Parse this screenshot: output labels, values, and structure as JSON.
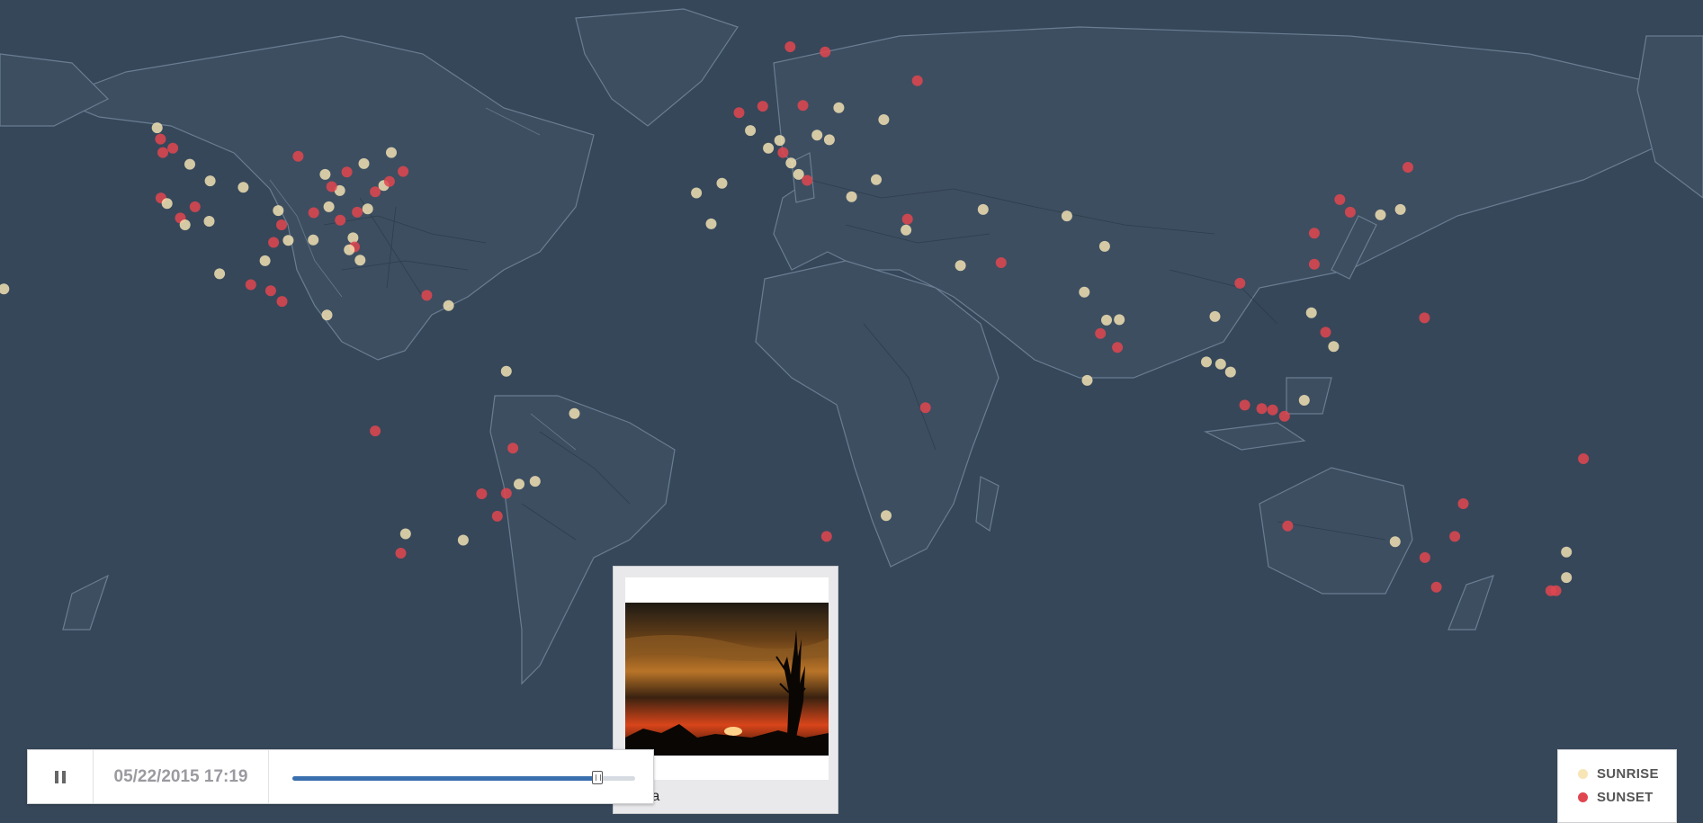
{
  "map": {
    "background": "#36475a",
    "land": "#3d4e61",
    "roads": "#2a3846"
  },
  "colors": {
    "sunrise": "#f7e5b5",
    "sunset": "#e0464f"
  },
  "points": [
    {
      "lon": -122.4,
      "lat": 47.6,
      "type": "sunset"
    },
    {
      "lon": -123.1,
      "lat": 49.3,
      "type": "sunrise"
    },
    {
      "lon": -121.9,
      "lat": 45.5,
      "type": "sunset"
    },
    {
      "lon": -119.8,
      "lat": 46.2,
      "type": "sunset"
    },
    {
      "lon": -116.2,
      "lat": 43.6,
      "type": "sunrise"
    },
    {
      "lon": -122.3,
      "lat": 37.8,
      "type": "sunset"
    },
    {
      "lon": -121.0,
      "lat": 36.8,
      "type": "sunrise"
    },
    {
      "lon": -118.2,
      "lat": 34.1,
      "type": "sunset"
    },
    {
      "lon": -117.2,
      "lat": 32.8,
      "type": "sunrise"
    },
    {
      "lon": -115.1,
      "lat": 36.2,
      "type": "sunset"
    },
    {
      "lon": -112.1,
      "lat": 33.5,
      "type": "sunrise"
    },
    {
      "lon": -111.9,
      "lat": 40.8,
      "type": "sunrise"
    },
    {
      "lon": -104.9,
      "lat": 39.7,
      "type": "sunrise"
    },
    {
      "lon": -97.5,
      "lat": 35.5,
      "type": "sunrise"
    },
    {
      "lon": -96.8,
      "lat": 32.8,
      "type": "sunset"
    },
    {
      "lon": -95.4,
      "lat": 29.8,
      "type": "sunrise"
    },
    {
      "lon": -98.5,
      "lat": 29.4,
      "type": "sunset"
    },
    {
      "lon": -90.1,
      "lat": 29.9,
      "type": "sunrise"
    },
    {
      "lon": -90.0,
      "lat": 35.1,
      "type": "sunset"
    },
    {
      "lon": -86.8,
      "lat": 36.2,
      "type": "sunrise"
    },
    {
      "lon": -84.4,
      "lat": 33.7,
      "type": "sunset"
    },
    {
      "lon": -81.7,
      "lat": 30.3,
      "type": "sunrise"
    },
    {
      "lon": -80.2,
      "lat": 25.8,
      "type": "sunrise"
    },
    {
      "lon": -81.4,
      "lat": 28.5,
      "type": "sunset"
    },
    {
      "lon": -82.5,
      "lat": 27.9,
      "type": "sunrise"
    },
    {
      "lon": -80.8,
      "lat": 35.2,
      "type": "sunset"
    },
    {
      "lon": -78.6,
      "lat": 35.8,
      "type": "sunrise"
    },
    {
      "lon": -77.0,
      "lat": 38.9,
      "type": "sunset"
    },
    {
      "lon": -75.2,
      "lat": 40.0,
      "type": "sunrise"
    },
    {
      "lon": -74.0,
      "lat": 40.7,
      "type": "sunset"
    },
    {
      "lon": -71.1,
      "lat": 42.4,
      "type": "sunset"
    },
    {
      "lon": -79.4,
      "lat": 43.7,
      "type": "sunrise"
    },
    {
      "lon": -83.0,
      "lat": 42.3,
      "type": "sunset"
    },
    {
      "lon": -87.6,
      "lat": 41.9,
      "type": "sunrise"
    },
    {
      "lon": -93.3,
      "lat": 44.9,
      "type": "sunset"
    },
    {
      "lon": -84.5,
      "lat": 39.1,
      "type": "sunrise"
    },
    {
      "lon": -86.2,
      "lat": 39.8,
      "type": "sunset"
    },
    {
      "lon": -73.6,
      "lat": 45.5,
      "type": "sunrise"
    },
    {
      "lon": -99.1,
      "lat": 19.4,
      "type": "sunset"
    },
    {
      "lon": -103.3,
      "lat": 20.7,
      "type": "sunset"
    },
    {
      "lon": -100.3,
      "lat": 25.7,
      "type": "sunrise"
    },
    {
      "lon": -109.9,
      "lat": 23.0,
      "type": "sunrise"
    },
    {
      "lon": -96.7,
      "lat": 17.1,
      "type": "sunset"
    },
    {
      "lon": -87.2,
      "lat": 14.1,
      "type": "sunrise"
    },
    {
      "lon": -66.1,
      "lat": 18.4,
      "type": "sunset"
    },
    {
      "lon": -61.5,
      "lat": 16.2,
      "type": "sunrise"
    },
    {
      "lon": -49.3,
      "lat": 1.5,
      "type": "sunrise"
    },
    {
      "lon": -34.9,
      "lat": -8.1,
      "type": "sunrise"
    },
    {
      "lon": -77.0,
      "lat": -12.0,
      "type": "sunset"
    },
    {
      "lon": -46.6,
      "lat": -23.5,
      "type": "sunrise"
    },
    {
      "lon": -43.2,
      "lat": -22.9,
      "type": "sunrise"
    },
    {
      "lon": -47.9,
      "lat": -15.8,
      "type": "sunset"
    },
    {
      "lon": -49.3,
      "lat": -25.4,
      "type": "sunset"
    },
    {
      "lon": -51.2,
      "lat": -30.0,
      "type": "sunset"
    },
    {
      "lon": -54.5,
      "lat": -25.5,
      "type": "sunset"
    },
    {
      "lon": -58.4,
      "lat": -34.6,
      "type": "sunrise"
    },
    {
      "lon": -70.6,
      "lat": -33.4,
      "type": "sunrise"
    },
    {
      "lon": -71.6,
      "lat": -37.0,
      "type": "sunset"
    },
    {
      "lon": -155.5,
      "lat": 19.8,
      "type": "sunrise"
    },
    {
      "lon": -157.8,
      "lat": 21.3,
      "type": "sunrise"
    },
    {
      "lon": 171.5,
      "lat": -43.5,
      "type": "sunset"
    },
    {
      "lon": 174.8,
      "lat": -36.8,
      "type": "sunrise"
    },
    {
      "lon": 178.4,
      "lat": -18.1,
      "type": "sunset"
    },
    {
      "lon": -0.1,
      "lat": 51.5,
      "type": "sunset"
    },
    {
      "lon": -3.7,
      "lat": 40.4,
      "type": "sunrise"
    },
    {
      "lon": -9.1,
      "lat": 38.7,
      "type": "sunrise"
    },
    {
      "lon": -6.0,
      "lat": 33.0,
      "type": "sunrise"
    },
    {
      "lon": 2.3,
      "lat": 48.9,
      "type": "sunrise"
    },
    {
      "lon": 4.9,
      "lat": 52.4,
      "type": "sunset"
    },
    {
      "lon": 6.1,
      "lat": 46.2,
      "type": "sunrise"
    },
    {
      "lon": 8.5,
      "lat": 47.4,
      "type": "sunrise"
    },
    {
      "lon": 9.2,
      "lat": 45.5,
      "type": "sunset"
    },
    {
      "lon": 10.9,
      "lat": 43.8,
      "type": "sunrise"
    },
    {
      "lon": 12.5,
      "lat": 41.9,
      "type": "sunrise"
    },
    {
      "lon": 13.4,
      "lat": 52.5,
      "type": "sunset"
    },
    {
      "lon": 16.4,
      "lat": 48.2,
      "type": "sunrise"
    },
    {
      "lon": 14.3,
      "lat": 40.9,
      "type": "sunset"
    },
    {
      "lon": 19.0,
      "lat": 47.5,
      "type": "sunrise"
    },
    {
      "lon": 21.0,
      "lat": 52.2,
      "type": "sunrise"
    },
    {
      "lon": 23.7,
      "lat": 38.0,
      "type": "sunrise"
    },
    {
      "lon": 28.9,
      "lat": 41.0,
      "type": "sunrise"
    },
    {
      "lon": 30.5,
      "lat": 50.5,
      "type": "sunrise"
    },
    {
      "lon": 37.6,
      "lat": 55.8,
      "type": "sunset"
    },
    {
      "lon": 18.1,
      "lat": 59.3,
      "type": "sunset"
    },
    {
      "lon": 10.7,
      "lat": 59.9,
      "type": "sunset"
    },
    {
      "lon": 35.2,
      "lat": 31.8,
      "type": "sunrise"
    },
    {
      "lon": 35.5,
      "lat": 33.9,
      "type": "sunset"
    },
    {
      "lon": 46.7,
      "lat": 24.7,
      "type": "sunrise"
    },
    {
      "lon": 55.3,
      "lat": 25.3,
      "type": "sunset"
    },
    {
      "lon": 51.5,
      "lat": 35.7,
      "type": "sunrise"
    },
    {
      "lon": 69.2,
      "lat": 34.5,
      "type": "sunrise"
    },
    {
      "lon": 72.9,
      "lat": 19.1,
      "type": "sunrise"
    },
    {
      "lon": 77.2,
      "lat": 28.6,
      "type": "sunrise"
    },
    {
      "lon": 77.6,
      "lat": 13.0,
      "type": "sunrise"
    },
    {
      "lon": 80.3,
      "lat": 13.1,
      "type": "sunrise"
    },
    {
      "lon": 76.3,
      "lat": 10.0,
      "type": "sunset"
    },
    {
      "lon": 79.9,
      "lat": 6.9,
      "type": "sunset"
    },
    {
      "lon": 73.5,
      "lat": -0.6,
      "type": "sunrise"
    },
    {
      "lon": 39.3,
      "lat": -6.8,
      "type": "sunset"
    },
    {
      "lon": 31.0,
      "lat": -29.9,
      "type": "sunrise"
    },
    {
      "lon": 18.4,
      "lat": -33.9,
      "type": "sunset"
    },
    {
      "lon": 100.5,
      "lat": 13.8,
      "type": "sunrise"
    },
    {
      "lon": 105.8,
      "lat": 21.0,
      "type": "sunset"
    },
    {
      "lon": 101.7,
      "lat": 3.1,
      "type": "sunrise"
    },
    {
      "lon": 103.8,
      "lat": 1.3,
      "type": "sunrise"
    },
    {
      "lon": 98.7,
      "lat": 3.6,
      "type": "sunrise"
    },
    {
      "lon": 106.8,
      "lat": -6.2,
      "type": "sunset"
    },
    {
      "lon": 110.4,
      "lat": -7.0,
      "type": "sunset"
    },
    {
      "lon": 112.7,
      "lat": -7.3,
      "type": "sunset"
    },
    {
      "lon": 115.2,
      "lat": -8.7,
      "type": "sunset"
    },
    {
      "lon": 120.9,
      "lat": 14.6,
      "type": "sunrise"
    },
    {
      "lon": 123.9,
      "lat": 10.3,
      "type": "sunset"
    },
    {
      "lon": 125.6,
      "lat": 7.1,
      "type": "sunrise"
    },
    {
      "lon": 119.4,
      "lat": -5.1,
      "type": "sunrise"
    },
    {
      "lon": 121.5,
      "lat": 25.0,
      "type": "sunset"
    },
    {
      "lon": 121.5,
      "lat": 31.2,
      "type": "sunset"
    },
    {
      "lon": 126.9,
      "lat": 37.5,
      "type": "sunset"
    },
    {
      "lon": 129.1,
      "lat": 35.2,
      "type": "sunset"
    },
    {
      "lon": 135.5,
      "lat": 34.7,
      "type": "sunrise"
    },
    {
      "lon": 139.7,
      "lat": 35.7,
      "type": "sunrise"
    },
    {
      "lon": 141.3,
      "lat": 43.1,
      "type": "sunset"
    },
    {
      "lon": 144.8,
      "lat": 13.5,
      "type": "sunset"
    },
    {
      "lon": 115.9,
      "lat": -31.9,
      "type": "sunset"
    },
    {
      "lon": 151.2,
      "lat": -33.9,
      "type": "sunset"
    },
    {
      "lon": 153.0,
      "lat": -27.5,
      "type": "sunset"
    },
    {
      "lon": 144.9,
      "lat": -37.8,
      "type": "sunset"
    },
    {
      "lon": 147.3,
      "lat": -42.9,
      "type": "sunset"
    },
    {
      "lon": 138.6,
      "lat": -34.9,
      "type": "sunrise"
    },
    {
      "lon": 174.8,
      "lat": -41.3,
      "type": "sunrise"
    },
    {
      "lon": 172.6,
      "lat": -43.5,
      "type": "sunset"
    },
    {
      "lon": -157.8,
      "lat": 21.3,
      "type": "sunrise"
    }
  ],
  "popup": {
    "caption": "vieira"
  },
  "player": {
    "time": "05/22/2015 17:19",
    "progress": 0.89
  },
  "legend": {
    "sunrise_label": "SUNRISE",
    "sunset_label": "SUNSET"
  }
}
